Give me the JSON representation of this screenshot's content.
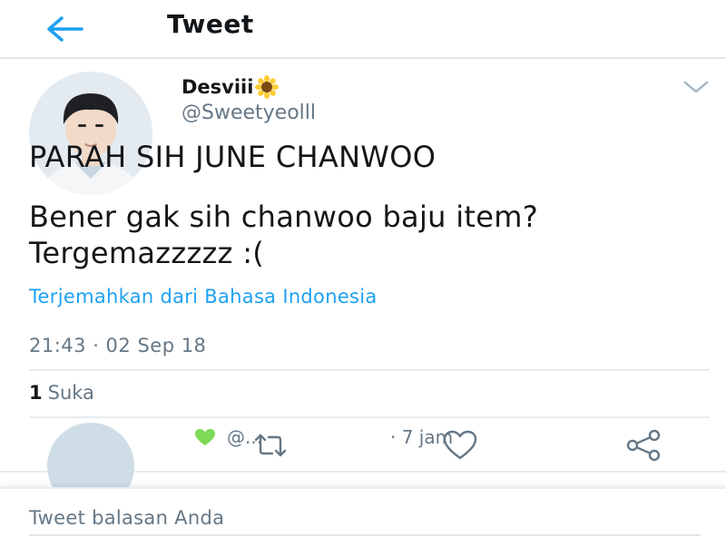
{
  "header": {
    "title": "Tweet",
    "back_icon": "arrow-left-icon"
  },
  "tweet": {
    "author_name": "Desviii",
    "author_emoji": "sunflower-icon",
    "author_handle": "@Sweetyeolll",
    "menu_icon": "chevron-down-icon",
    "text_line1": "PARAH SIH JUNE CHANWOO",
    "text_line2": "Bener gak sih chanwoo baju item? Tergemazzzzz :(",
    "translate_label": "Terjemahkan dari Bahasa Indonesia",
    "timestamp": "21:43 · 02 Sep 18",
    "like_count": "1",
    "like_label": "Suka",
    "actions": [
      "reply-icon",
      "retweet-icon",
      "like-icon",
      "share-icon"
    ]
  },
  "reply_preview": {
    "handle": "@...",
    "time": "· 7 jam"
  },
  "compose": {
    "placeholder": "Tweet balasan Anda"
  },
  "colors": {
    "accent": "#1da1f2",
    "secondary_text": "#657786",
    "divider": "#e6ecf0"
  }
}
